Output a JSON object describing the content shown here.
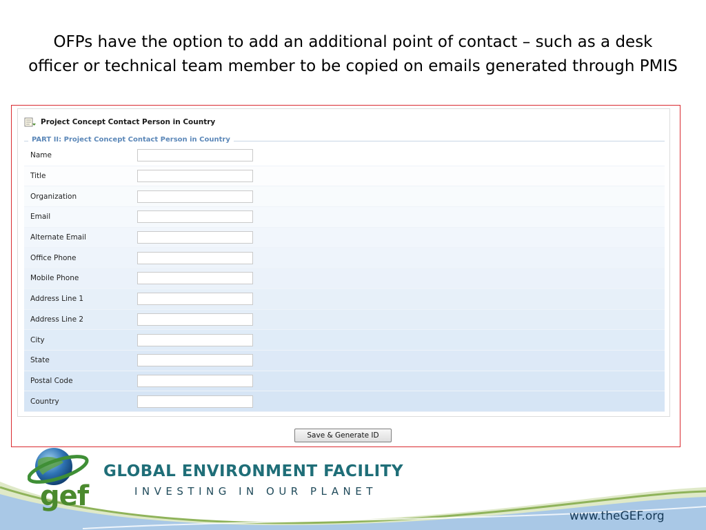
{
  "slide": {
    "title": "OFPs have the option to add an additional point of contact – such as a desk officer or technical team member to be copied on emails generated through PMIS"
  },
  "panel": {
    "header": "Project Concept Contact Person in Country",
    "icon": "form-edit-icon",
    "legend": "PART II: Project Concept Contact Person in Country",
    "fields": [
      {
        "label": "Name",
        "value": ""
      },
      {
        "label": "Title",
        "value": ""
      },
      {
        "label": "Organization",
        "value": ""
      },
      {
        "label": "Email",
        "value": ""
      },
      {
        "label": "Alternate Email",
        "value": ""
      },
      {
        "label": "Office Phone",
        "value": ""
      },
      {
        "label": "Mobile Phone",
        "value": ""
      },
      {
        "label": "Address Line 1",
        "value": ""
      },
      {
        "label": "Address Line 2",
        "value": ""
      },
      {
        "label": "City",
        "value": ""
      },
      {
        "label": "State",
        "value": ""
      },
      {
        "label": "Postal Code",
        "value": ""
      },
      {
        "label": "Country",
        "value": ""
      }
    ],
    "save_button": "Save & Generate ID"
  },
  "footer": {
    "logo_text": "gef",
    "org_name": "GLOBAL ENVIRONMENT FACILITY",
    "tagline": "INVESTING IN OUR PLANET",
    "website": "www.theGEF.org"
  },
  "colors": {
    "highlight_border": "#d9282e",
    "legend_text": "#5b87b8",
    "row_gradient_start": "#ffffff",
    "row_gradient_end": "#d6e5f5",
    "org_name": "#1f6e78",
    "logo_green": "#4b8a2e"
  }
}
